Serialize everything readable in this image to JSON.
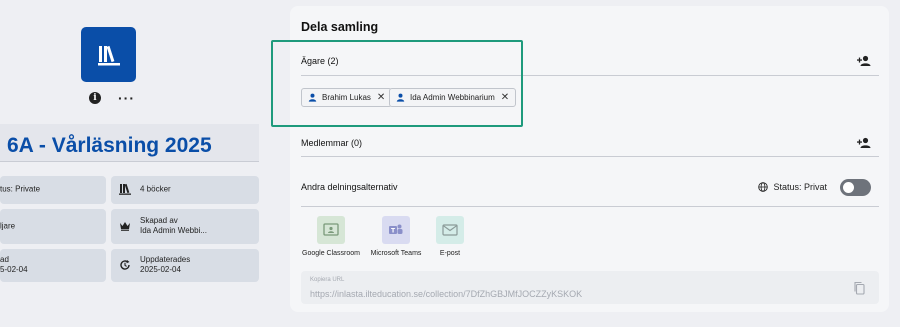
{
  "collection": {
    "title": "6A - Vårläsning 2025",
    "cards": {
      "status": "tus: Private",
      "books": "4 böcker",
      "readers": "ljare",
      "created_label": "Skapad av",
      "created_by": "Ida Admin Webbi...",
      "date_label": "ad",
      "date_value": "5-02-04",
      "updated_label": "Uppdaterades",
      "updated_value": "2025-02-04"
    }
  },
  "share": {
    "title": "Dela samling",
    "owners_label": "Ägare (2)",
    "owners": [
      "Brahim Lukas",
      "Ida Admin Webbinarium"
    ],
    "members_label": "Medlemmar (0)",
    "other_label": "Andra delningsalternativ",
    "status_text": "Status: Privat",
    "options": [
      {
        "label": "Google Classroom",
        "color": "#d6e6d6",
        "icon": "google-classroom-icon"
      },
      {
        "label": "Microsoft Teams",
        "color": "#d9dbf1",
        "icon": "microsoft-teams-icon"
      },
      {
        "label": "E-post",
        "color": "#d4ece8",
        "icon": "email-icon"
      }
    ],
    "url_label": "Kopiera URL",
    "url": "https://inlasta.ilteducation.se/collection/7DfZhGBJMfJOCZZyKSKOK"
  },
  "colors": {
    "brand": "#0a4ea8",
    "highlight": "#1e9a7c"
  }
}
